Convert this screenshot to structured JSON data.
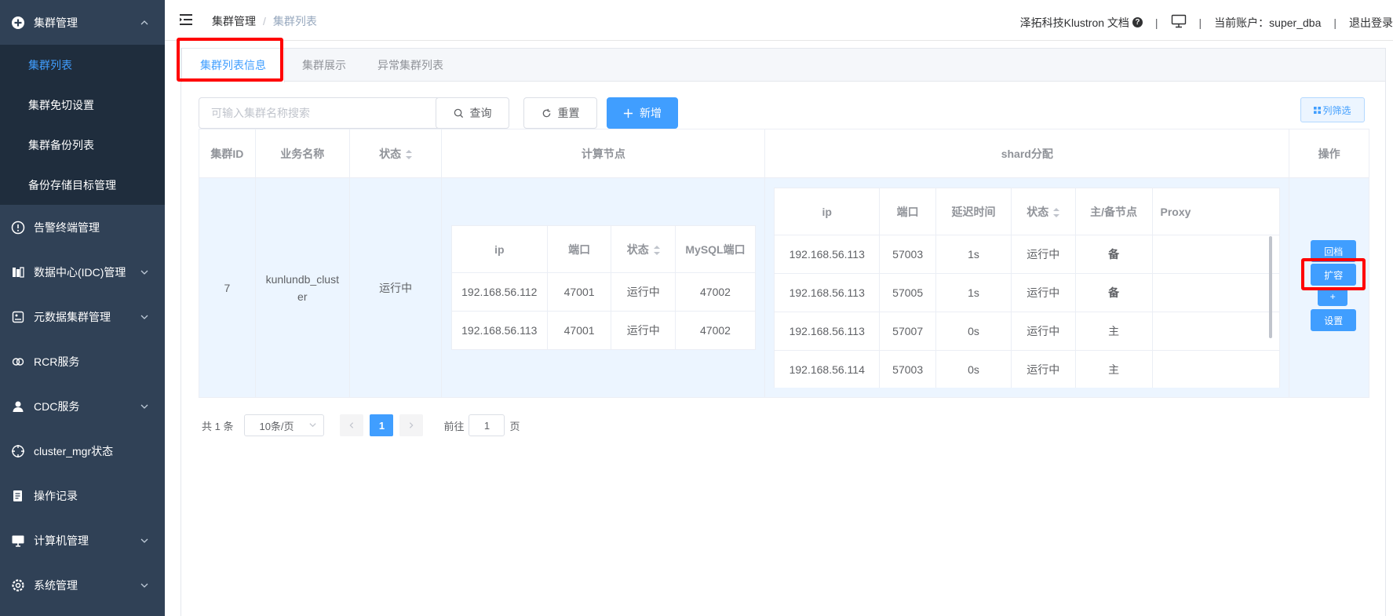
{
  "sidebar": {
    "items": [
      {
        "label": "集群管理",
        "icon": "plus-circle-icon",
        "expanded": true
      },
      {
        "label": "告警终端管理",
        "icon": "alert-circle-icon"
      },
      {
        "label": "数据中心(IDC)管理",
        "icon": "datacenter-icon"
      },
      {
        "label": "元数据集群管理",
        "icon": "metadata-icon"
      },
      {
        "label": "RCR服务",
        "icon": "link-icon"
      },
      {
        "label": "CDC服务",
        "icon": "user-icon"
      },
      {
        "label": "cluster_mgr状态",
        "icon": "crosshair-icon"
      },
      {
        "label": "操作记录",
        "icon": "record-icon"
      },
      {
        "label": "计算机管理",
        "icon": "monitor-icon"
      },
      {
        "label": "系统管理",
        "icon": "gear-icon"
      }
    ],
    "submenu": [
      {
        "label": "集群列表"
      },
      {
        "label": "集群免切设置"
      },
      {
        "label": "集群备份列表"
      },
      {
        "label": "备份存储目标管理"
      }
    ]
  },
  "header": {
    "breadcrumb": [
      "集群管理",
      "集群列表"
    ],
    "breadcrumb_sep": "/",
    "docs": "泽拓科技Klustron 文档",
    "account": "当前账户：super_dba",
    "logout": "退出登录",
    "sep": "|"
  },
  "tabs": [
    {
      "label": "集群列表信息"
    },
    {
      "label": "集群展示"
    },
    {
      "label": "异常集群列表"
    }
  ],
  "toolbar": {
    "search_placeholder": "可输入集群名称搜索",
    "query": "查询",
    "reset": "重置",
    "add": "新增",
    "column_filter": "列筛选"
  },
  "table": {
    "headers": {
      "id": "集群ID",
      "name": "业务名称",
      "status": "状态",
      "compute": "计算节点",
      "shard": "shard分配",
      "ops": "操作"
    },
    "row": {
      "id": "7",
      "name": "kunlundb_cluster",
      "status": "运行中"
    },
    "compute_headers": [
      "ip",
      "端口",
      "状态",
      "MySQL端口"
    ],
    "compute_rows": [
      [
        "192.168.56.112",
        "47001",
        "运行中",
        "47002"
      ],
      [
        "192.168.56.113",
        "47001",
        "运行中",
        "47002"
      ]
    ],
    "shard_headers": [
      "ip",
      "端口",
      "延迟时间",
      "状态",
      "主/备节点",
      "Proxy"
    ],
    "shard_rows": [
      [
        "192.168.56.113",
        "57003",
        "1s",
        "运行中",
        "备",
        ""
      ],
      [
        "192.168.56.113",
        "57005",
        "1s",
        "运行中",
        "备",
        ""
      ],
      [
        "192.168.56.113",
        "57007",
        "0s",
        "运行中",
        "主",
        ""
      ],
      [
        "192.168.56.114",
        "57003",
        "0s",
        "运行中",
        "主",
        ""
      ]
    ],
    "ops": {
      "rollback": "回档",
      "expand": "扩容",
      "plus": "+",
      "settings": "设置"
    }
  },
  "pagination": {
    "total": "共 1 条",
    "page_size": "10条/页",
    "current": "1",
    "goto_prefix": "前往",
    "goto_value": "1",
    "goto_suffix": "页"
  },
  "colors": {
    "sidebar_bg": "#304156",
    "submenu_bg": "#1f2d3d",
    "primary": "#409eff",
    "success": "#67c23a",
    "highlight": "#ff0000"
  }
}
